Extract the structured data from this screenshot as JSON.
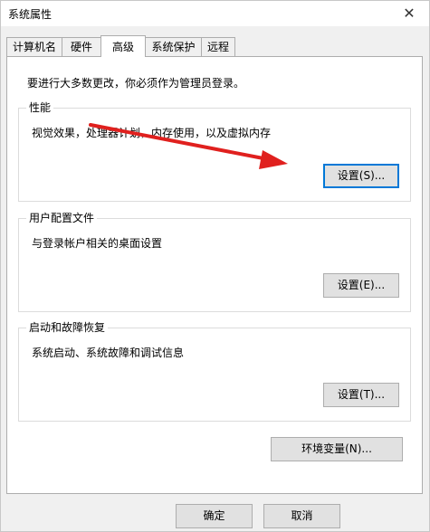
{
  "window": {
    "title": "系统属性",
    "close_glyph": "✕"
  },
  "tabs": [
    {
      "label": "计算机名",
      "active": false
    },
    {
      "label": "硬件",
      "active": false
    },
    {
      "label": "高级",
      "active": true
    },
    {
      "label": "系统保护",
      "active": false
    },
    {
      "label": "远程",
      "active": false
    }
  ],
  "panel": {
    "notice": "要进行大多数更改，你必须作为管理员登录。",
    "performance": {
      "title": "性能",
      "description": "视觉效果，处理器计划，内存使用，以及虚拟内存",
      "button": "设置(S)..."
    },
    "user_profiles": {
      "title": "用户配置文件",
      "description": "与登录帐户相关的桌面设置",
      "button": "设置(E)..."
    },
    "startup_recovery": {
      "title": "启动和故障恢复",
      "description": "系统启动、系统故障和调试信息",
      "button": "设置(T)..."
    },
    "env_button": "环境变量(N)..."
  },
  "footer": {
    "ok": "确定",
    "cancel": "取消"
  },
  "colors": {
    "accent": "#0078d7",
    "annotation_arrow": "#e0201e"
  }
}
